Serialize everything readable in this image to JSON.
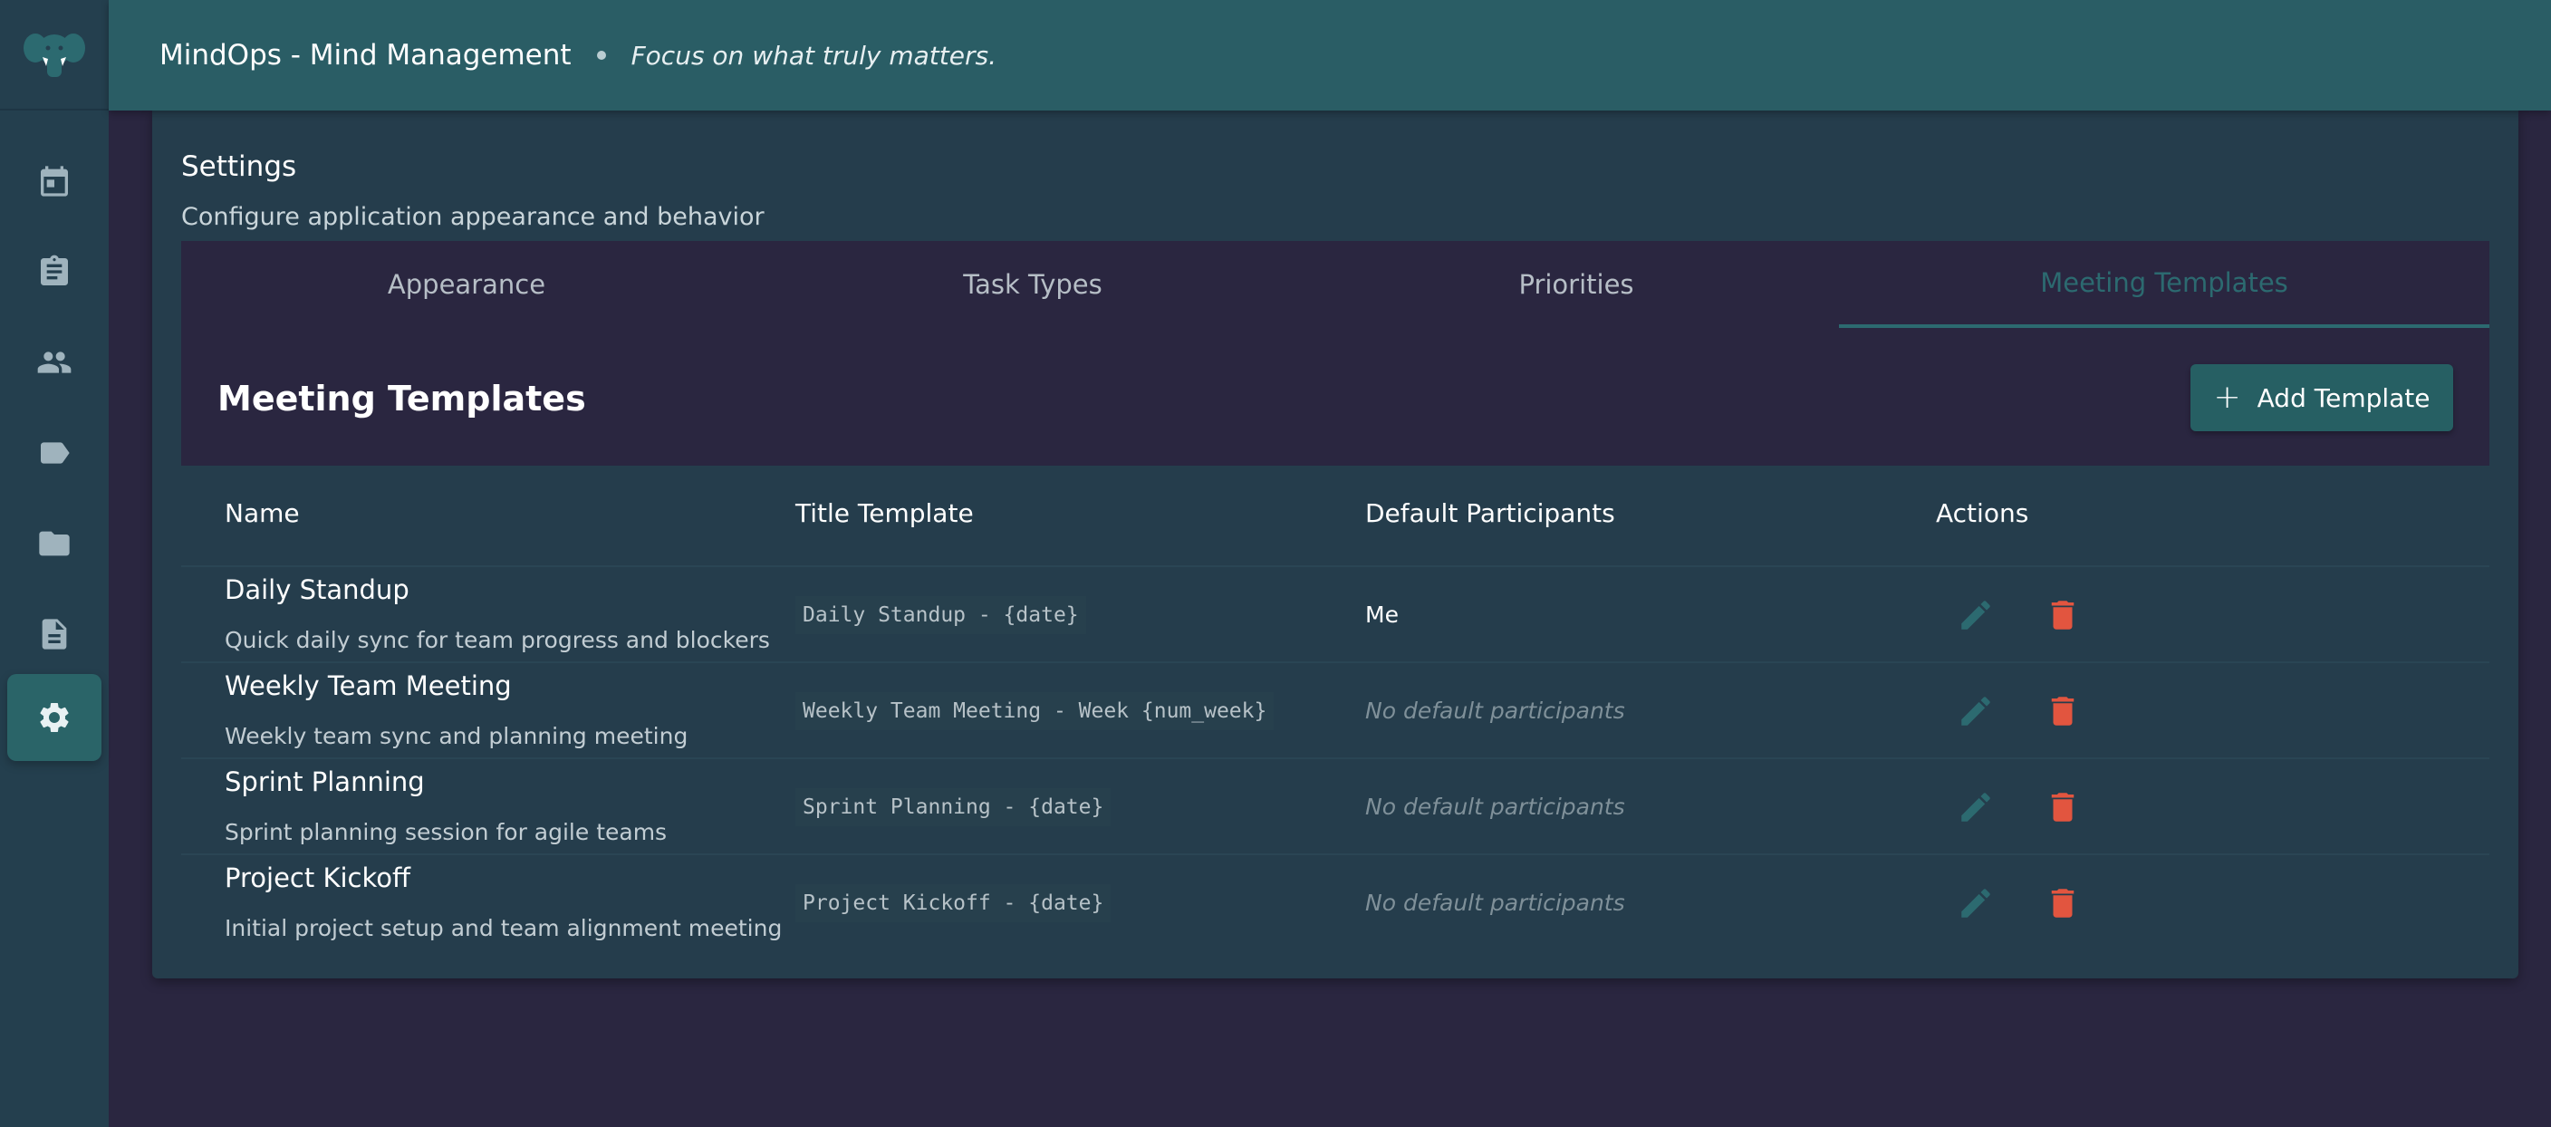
{
  "header": {
    "app_title": "MindOps - Mind Management",
    "tagline": "Focus on what truly matters."
  },
  "sidebar": {
    "items": [
      {
        "icon": "calendar-icon",
        "active": false
      },
      {
        "icon": "clipboard-icon",
        "active": false
      },
      {
        "icon": "people-icon",
        "active": false
      },
      {
        "icon": "label-icon",
        "active": false
      },
      {
        "icon": "folder-icon",
        "active": false
      },
      {
        "icon": "document-icon",
        "active": false
      },
      {
        "icon": "gear-icon",
        "active": true
      }
    ]
  },
  "settings": {
    "title": "Settings",
    "subtitle": "Configure application appearance and behavior"
  },
  "tabs": [
    {
      "label": "Appearance",
      "active": false
    },
    {
      "label": "Task Types",
      "active": false
    },
    {
      "label": "Priorities",
      "active": false
    },
    {
      "label": "Meeting Templates",
      "active": true
    }
  ],
  "section": {
    "title": "Meeting Templates",
    "add_button_label": "Add Template"
  },
  "table": {
    "headers": [
      "Name",
      "Title Template",
      "Default Participants",
      "Actions"
    ],
    "rows": [
      {
        "name": "Daily Standup",
        "description": "Quick daily sync for team progress and blockers",
        "title_template": "Daily Standup - {date}",
        "participants": "Me",
        "has_participants": true
      },
      {
        "name": "Weekly Team Meeting",
        "description": "Weekly team sync and planning meeting",
        "title_template": "Weekly Team Meeting - Week {num_week}",
        "participants": "No default participants",
        "has_participants": false
      },
      {
        "name": "Sprint Planning",
        "description": "Sprint planning session for agile teams",
        "title_template": "Sprint Planning - {date}",
        "participants": "No default participants",
        "has_participants": false
      },
      {
        "name": "Project Kickoff",
        "description": "Initial project setup and team alignment meeting",
        "title_template": "Project Kickoff - {date}",
        "participants": "No default participants",
        "has_participants": false
      }
    ]
  },
  "colors": {
    "accent": "#2c6a70",
    "header_bg": "#2a5d65",
    "delete": "#e2553f",
    "page_bg": "#2a2640"
  }
}
